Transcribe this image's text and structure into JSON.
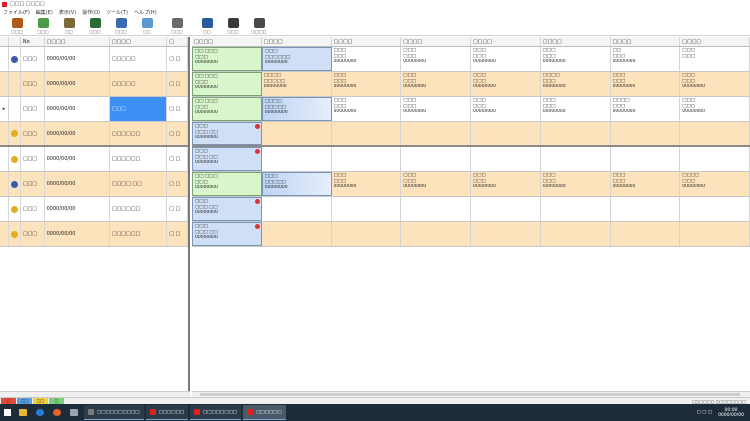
{
  "window": {
    "title": "□□□ □□□□"
  },
  "menu": [
    "ファイル(F)",
    "編集(E)",
    "表示(V)",
    "操作(O)",
    "ツール(T)",
    "ヘルプ(H)"
  ],
  "toolbar": [
    {
      "label": "□□□",
      "color": "#b05a1a"
    },
    {
      "label": "□□□",
      "color": "#4a9a4a"
    },
    {
      "label": "□□",
      "color": "#7a6a3a"
    },
    {
      "label": "□□□",
      "color": "#2a6a3a"
    },
    {
      "label": "□□□",
      "color": "#3a6ab0"
    },
    {
      "label": "□□",
      "color": "#5a9ad0"
    },
    {
      "label": "□□□",
      "color": "#6a6a6a"
    },
    {
      "label": "□□",
      "color": "#2a5a9a"
    },
    {
      "label": "□□□",
      "color": "#3a3a3a"
    },
    {
      "label": "□□□□",
      "color": "#4a4a4a"
    }
  ],
  "left_headers": [
    "",
    "",
    "No",
    "□□□□",
    "□□□□",
    "□"
  ],
  "right_headers": [
    "□□□□",
    "□□□□",
    "□□□□",
    "□□□□",
    "□□□□",
    "□□□□",
    "□□□□",
    "□□□□"
  ],
  "rows": [
    {
      "bg": "white",
      "mark": "",
      "icon_color": "#3a5ab0",
      "no": "□□□",
      "date": "0000/00/00",
      "name": "□□□□□",
      "n": "□ □",
      "cells": [
        {
          "style": "green",
          "lines": [
            "□□ □□□",
            "□□□",
            "00000000"
          ]
        },
        {
          "style": "blue",
          "lines": [
            "□□□",
            "□□□□□□",
            "00000000"
          ]
        },
        {
          "style": "",
          "lines": [
            "□□□",
            "□□□",
            "00000000"
          ]
        },
        {
          "style": "",
          "lines": [
            "□□□",
            "□□□",
            "00000000"
          ]
        },
        {
          "style": "",
          "lines": [
            "□□□",
            "□□□",
            "00000000"
          ]
        },
        {
          "style": "",
          "lines": [
            "□□□",
            "□□□",
            "00000000"
          ]
        },
        {
          "style": "",
          "lines": [
            "□□",
            "□□□",
            "00000000"
          ]
        },
        {
          "style": "",
          "lines": [
            "□□□",
            "□□□",
            ""
          ]
        }
      ]
    },
    {
      "bg": "orange",
      "mark": "",
      "icon_color": "",
      "no": "□□□",
      "date": "0000/00/00",
      "name": "□□□□□",
      "n": "□ □",
      "cells": [
        {
          "style": "green",
          "lines": [
            "□□ □□□",
            "□□□",
            "00000000"
          ]
        },
        {
          "style": "",
          "lines": [
            "□□□□",
            "□□□□□",
            "00000000"
          ]
        },
        {
          "style": "",
          "lines": [
            "□□□",
            "□□□",
            "00000000"
          ]
        },
        {
          "style": "",
          "lines": [
            "□□□",
            "□□□",
            "00000000"
          ]
        },
        {
          "style": "",
          "lines": [
            "□□□",
            "□□□",
            "00000000"
          ]
        },
        {
          "style": "",
          "lines": [
            "□□□□",
            "□□□",
            "00000000"
          ]
        },
        {
          "style": "",
          "lines": [
            "□□□",
            "□□□",
            "00000000"
          ]
        },
        {
          "style": "",
          "lines": [
            "□□□",
            "□□□",
            "00000000"
          ]
        }
      ]
    },
    {
      "bg": "white",
      "mark": "▸",
      "icon_color": "",
      "no": "□□□",
      "date": "0000/00/00",
      "name": "□□□",
      "selected": true,
      "n": "□ □",
      "cells": [
        {
          "style": "green",
          "lines": [
            "□□ □□□",
            "□□□",
            "00000000"
          ]
        },
        {
          "style": "bluegrad",
          "lines": [
            "□□□□",
            "□□□□□",
            "00000000"
          ]
        },
        {
          "style": "",
          "lines": [
            "□□□",
            "□□□",
            "00000000"
          ]
        },
        {
          "style": "",
          "lines": [
            "□□□",
            "□□□",
            "00000000"
          ]
        },
        {
          "style": "",
          "lines": [
            "□□□",
            "□□□",
            "00000000"
          ]
        },
        {
          "style": "",
          "lines": [
            "□□□",
            "□□□",
            "00000000"
          ]
        },
        {
          "style": "",
          "lines": [
            "□□□□",
            "□□□",
            "00000000"
          ]
        },
        {
          "style": "",
          "lines": [
            "□□□",
            "□□□",
            "00000000"
          ]
        }
      ]
    },
    {
      "bg": "orange",
      "thick": true,
      "mark": "",
      "icon_color": "#e0b020",
      "no": "□□□",
      "date": "0000/00/00",
      "name": "□□□□□□",
      "n": "□ □",
      "cells": [
        {
          "style": "blue",
          "dot": true,
          "lines": [
            "□□□",
            "□□□ □□",
            "00000000"
          ]
        },
        {
          "style": "",
          "lines": []
        },
        {
          "style": "",
          "lines": []
        },
        {
          "style": "",
          "lines": []
        },
        {
          "style": "",
          "lines": []
        },
        {
          "style": "",
          "lines": []
        },
        {
          "style": "",
          "lines": []
        },
        {
          "style": "",
          "lines": []
        }
      ]
    },
    {
      "bg": "white",
      "mark": "",
      "icon_color": "#e0b020",
      "no": "□□□",
      "date": "0000/00/00",
      "name": "□□□□□□",
      "n": "□ □",
      "cells": [
        {
          "style": "blue",
          "dot": true,
          "lines": [
            "□□□",
            "□□□ □□",
            "00000000"
          ]
        },
        {
          "style": "",
          "lines": []
        },
        {
          "style": "",
          "lines": []
        },
        {
          "style": "",
          "lines": []
        },
        {
          "style": "",
          "lines": []
        },
        {
          "style": "",
          "lines": []
        },
        {
          "style": "",
          "lines": []
        },
        {
          "style": "",
          "lines": []
        }
      ]
    },
    {
      "bg": "orange",
      "mark": "",
      "icon_color": "#3a5ab0",
      "no": "□□□",
      "date": "0000/00/00",
      "name": "□□□□ □□",
      "n": "□ □",
      "cells": [
        {
          "style": "green",
          "lines": [
            "□□ □□□",
            "□□□",
            "00000000"
          ]
        },
        {
          "style": "bluegrad",
          "lines": [
            "□□□",
            "□□□□□",
            "00000000"
          ]
        },
        {
          "style": "",
          "lines": [
            "□□□",
            "□□□",
            "00000000"
          ]
        },
        {
          "style": "",
          "lines": [
            "□□□",
            "□□□",
            "00000000"
          ]
        },
        {
          "style": "",
          "lines": [
            "□□□",
            "□□□",
            "00000000"
          ]
        },
        {
          "style": "",
          "lines": [
            "□□□",
            "□□□",
            "00000000"
          ]
        },
        {
          "style": "",
          "lines": [
            "□□□",
            "□□□",
            "00000000"
          ]
        },
        {
          "style": "",
          "lines": [
            "□□□□",
            "□□□",
            "00000000"
          ]
        }
      ]
    },
    {
      "bg": "white",
      "mark": "",
      "icon_color": "#e0b020",
      "no": "□□□",
      "date": "0000/00/00",
      "name": "□□□□□□",
      "n": "□ □",
      "cells": [
        {
          "style": "blue",
          "dot": true,
          "lines": [
            "□□□",
            "□□□ □□",
            "00000000"
          ]
        },
        {
          "style": "",
          "lines": []
        },
        {
          "style": "",
          "lines": []
        },
        {
          "style": "",
          "lines": []
        },
        {
          "style": "",
          "lines": []
        },
        {
          "style": "",
          "lines": []
        },
        {
          "style": "",
          "lines": []
        },
        {
          "style": "",
          "lines": []
        }
      ]
    },
    {
      "bg": "orange",
      "mark": "",
      "icon_color": "#e0b020",
      "no": "□□□",
      "date": "0000/00/00",
      "name": "□□□□□□",
      "n": "□ □",
      "cells": [
        {
          "style": "blue",
          "dot": true,
          "lines": [
            "□□□",
            "□□□ □□",
            "00000000"
          ]
        },
        {
          "style": "",
          "lines": []
        },
        {
          "style": "",
          "lines": []
        },
        {
          "style": "",
          "lines": []
        },
        {
          "style": "",
          "lines": []
        },
        {
          "style": "",
          "lines": []
        },
        {
          "style": "",
          "lines": []
        },
        {
          "style": "",
          "lines": []
        }
      ]
    }
  ],
  "status_tabs": [
    {
      "label": "□",
      "color": "#e24a3a"
    },
    {
      "label": "□□",
      "color": "#5aa0e0"
    },
    {
      "label": "□□",
      "color": "#f0d040"
    },
    {
      "label": "□",
      "color": "#7ad07a"
    }
  ],
  "status_text": "□□□□□□ □□□□□□□□",
  "taskbar": {
    "tasks": [
      {
        "label": "□□□□□□□□□□",
        "color": "#7a7a7a",
        "active": false
      },
      {
        "label": "□□□□□□",
        "color": "#d22",
        "active": false
      },
      {
        "label": "□□□□□□□□",
        "color": "#d22",
        "active": false
      },
      {
        "label": "□□□□□□",
        "color": "#d22",
        "active": true
      }
    ],
    "tray_text": "□ □ □",
    "time": "00:00",
    "date": "0000/00/00"
  }
}
